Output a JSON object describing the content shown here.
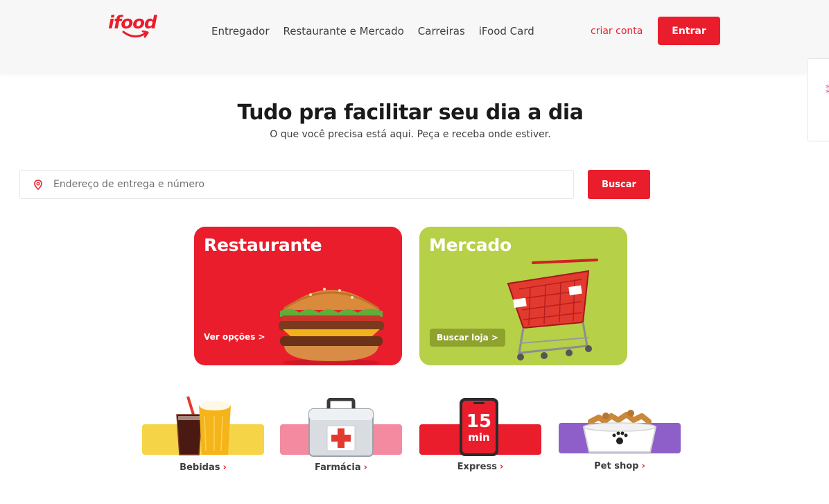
{
  "header": {
    "logo_text": "ifood",
    "nav": [
      "Entregador",
      "Restaurante e Mercado",
      "Carreiras",
      "iFood Card"
    ],
    "criar_conta": "criar conta",
    "entrar": "Entrar"
  },
  "hero": {
    "title": "Tudo pra facilitar seu dia a dia",
    "subtitle": "O que você precisa está aqui. Peça e receba onde estiver."
  },
  "search": {
    "placeholder": "Endereço de entrega e número",
    "button": "Buscar"
  },
  "cards": {
    "restaurante": {
      "title": "Restaurante",
      "link": "Ver opções >"
    },
    "mercado": {
      "title": "Mercado",
      "link": "Buscar loja >"
    }
  },
  "categories": [
    {
      "label": "Bebidas",
      "chevron": "›"
    },
    {
      "label": "Farmácia",
      "chevron": "›"
    },
    {
      "label": "Express",
      "chevron": "›"
    },
    {
      "label": "Pet shop",
      "chevron": "›"
    }
  ],
  "express_icon": {
    "number": "15",
    "unit": "min"
  },
  "colors": {
    "brand_red": "#ea1d2c",
    "mercado_green": "#b6d048",
    "bebidas_yellow": "#f5d547",
    "farmacia_pink": "#f38aa0",
    "pet_purple": "#8e5fc8"
  }
}
